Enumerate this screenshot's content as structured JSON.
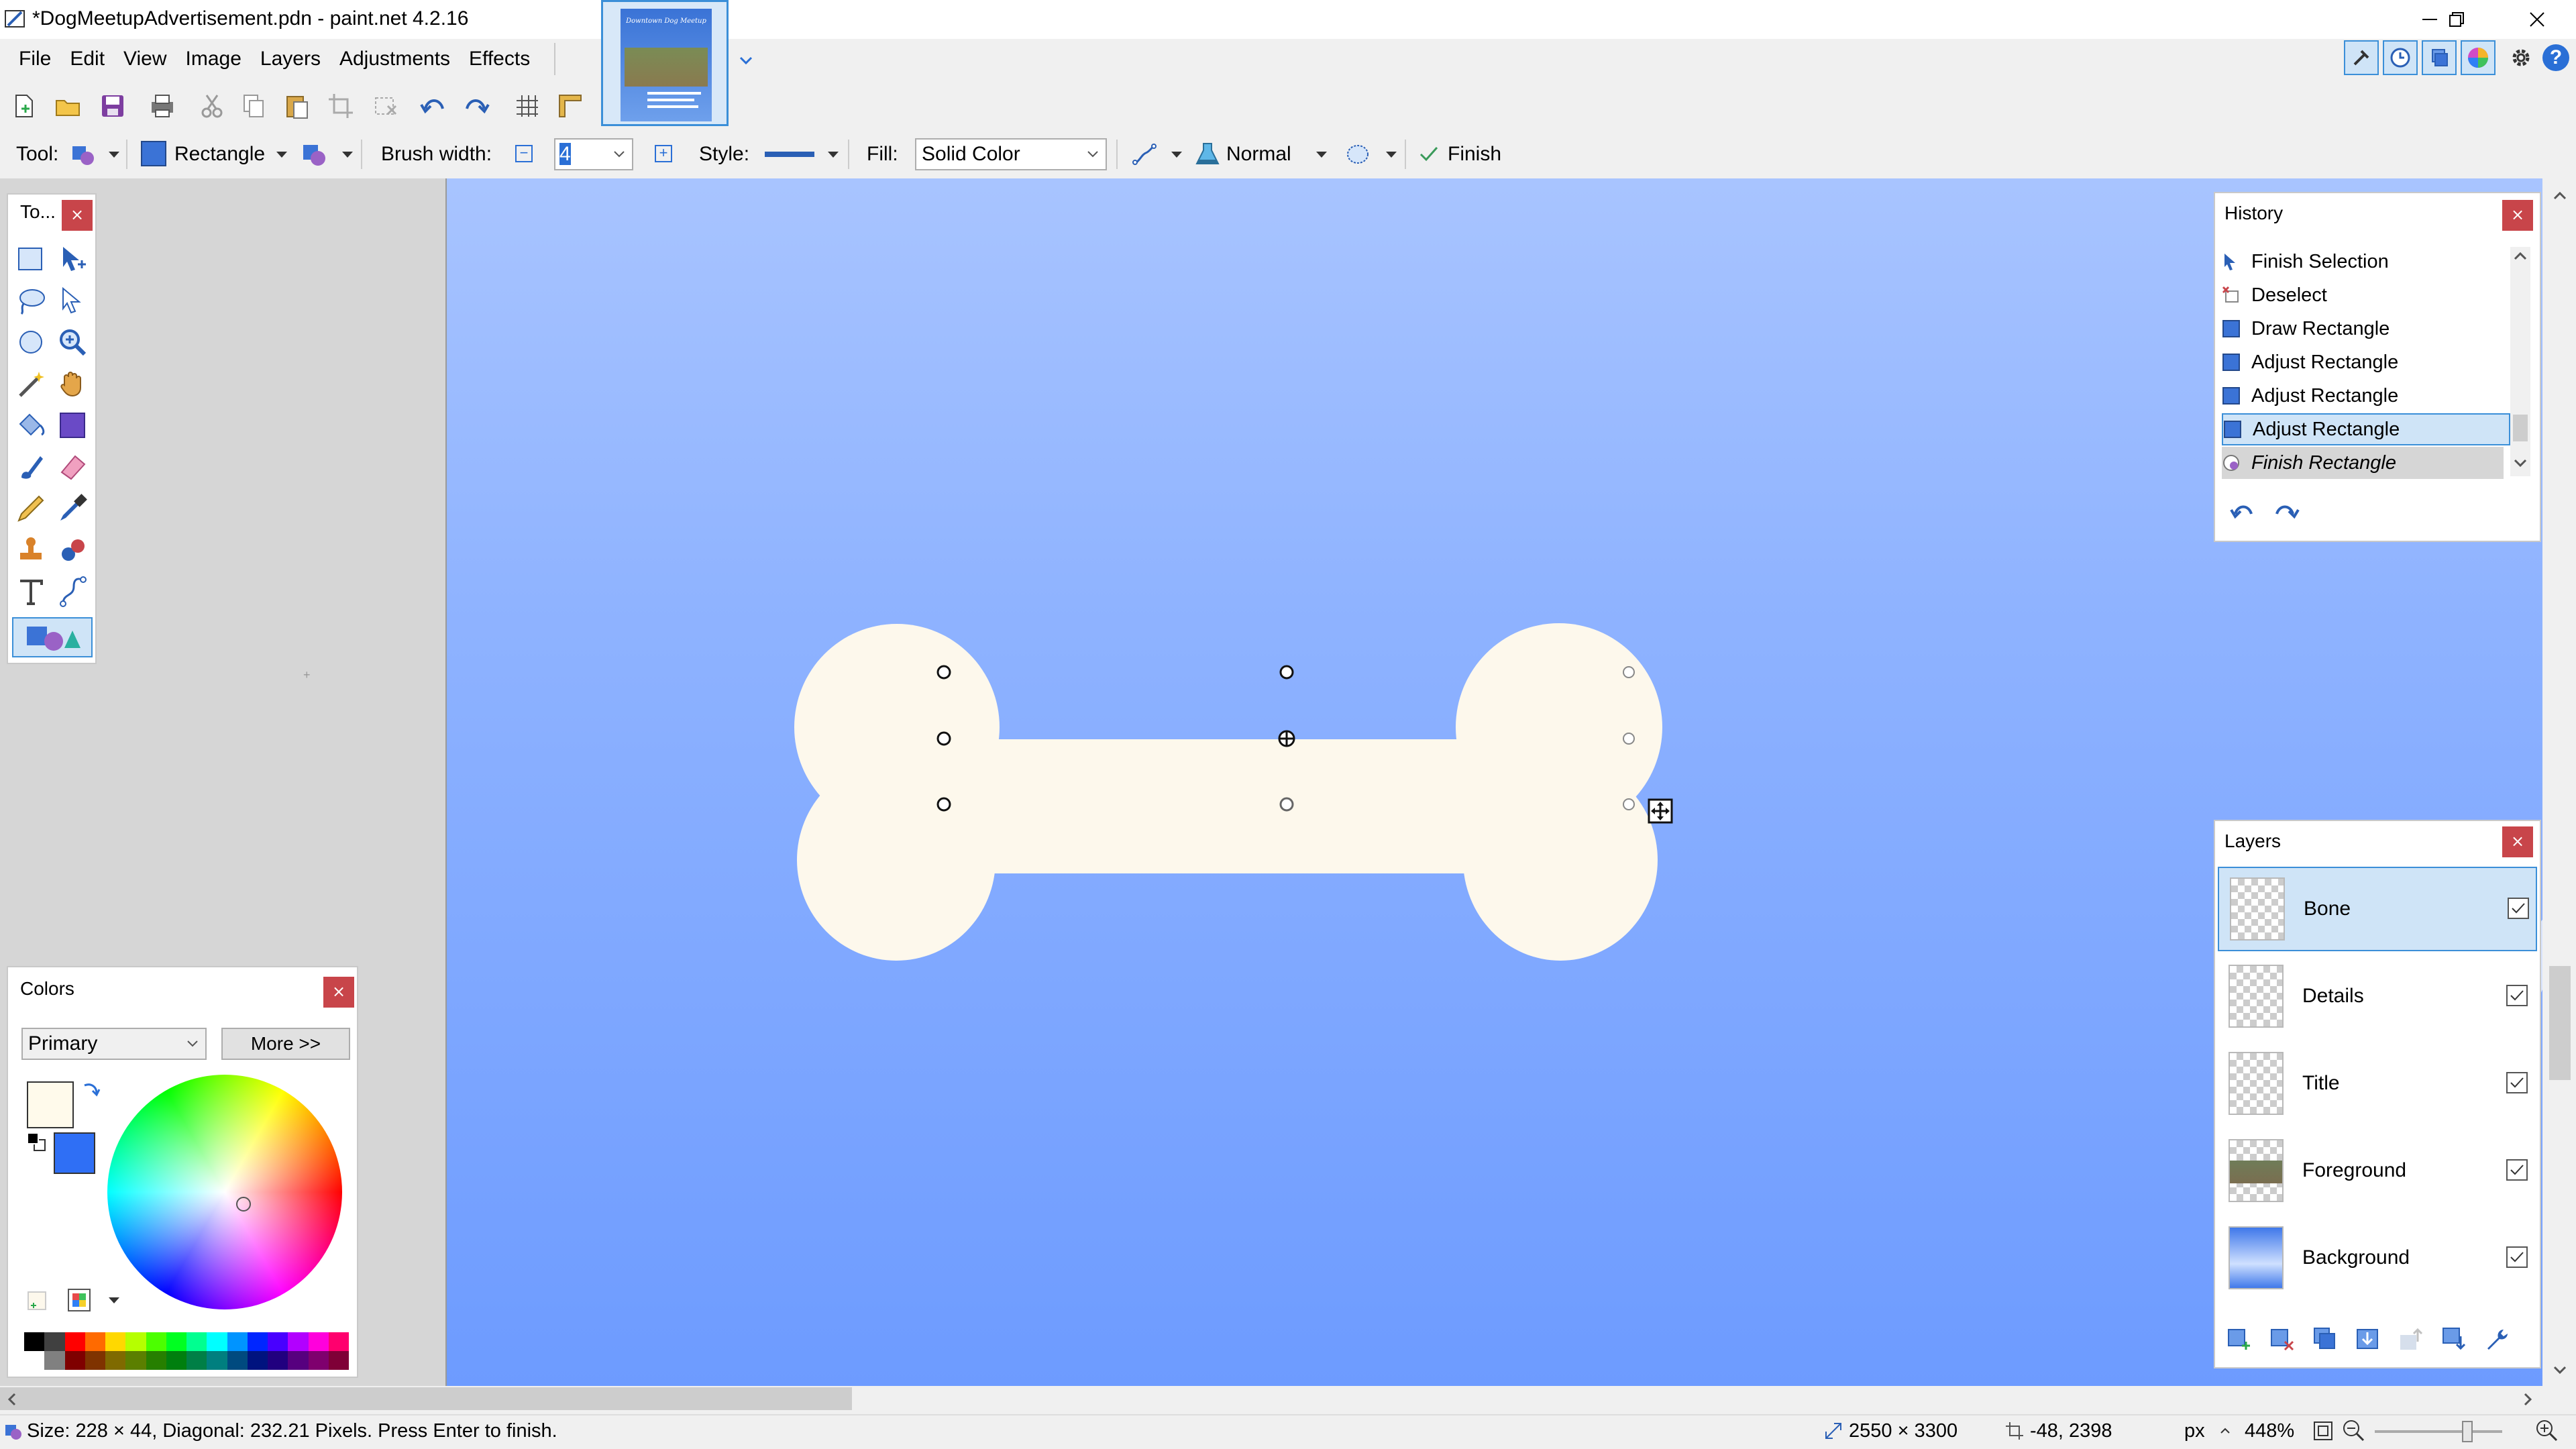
{
  "window": {
    "title": "*DogMeetupAdvertisement.pdn - paint.net 4.2.16"
  },
  "menu": [
    "File",
    "Edit",
    "View",
    "Image",
    "Layers",
    "Adjustments",
    "Effects"
  ],
  "thumbnail": {
    "title": "Downtown Dog Meetup"
  },
  "toolbar": {
    "icons": [
      "new-icon",
      "open-icon",
      "save-icon",
      "print-icon",
      "cut-icon",
      "copy-icon",
      "paste-icon",
      "crop-icon",
      "deselect-icon",
      "undo-icon",
      "redo-icon",
      "grid-icon",
      "rulers-icon"
    ]
  },
  "tool_options": {
    "tool_label": "Tool:",
    "shape": "Rectangle",
    "brush_width_label": "Brush width:",
    "brush_width": "4",
    "style_label": "Style:",
    "fill_label": "Fill:",
    "fill_value": "Solid Color",
    "blend_mode": "Normal",
    "finish_label": "Finish"
  },
  "tools_panel": {
    "title": "To..."
  },
  "history": {
    "title": "History",
    "items": [
      "Finish Selection",
      "Deselect",
      "Draw Rectangle",
      "Adjust Rectangle",
      "Adjust Rectangle",
      "Adjust Rectangle",
      "Finish Rectangle"
    ]
  },
  "layers": {
    "title": "Layers",
    "items": [
      "Bone",
      "Details",
      "Title",
      "Foreground",
      "Background"
    ]
  },
  "colors": {
    "title": "Colors",
    "mode": "Primary",
    "more_label": "More >>",
    "primary": "#fffaeb",
    "secondary": "#2f6ff5"
  },
  "status": {
    "message": "Size: 228 × 44, Diagonal: 232.21 Pixels. Press Enter to finish.",
    "image_size": "2550 × 3300",
    "cursor_pos": "-48, 2398",
    "units": "px",
    "zoom": "448%"
  }
}
